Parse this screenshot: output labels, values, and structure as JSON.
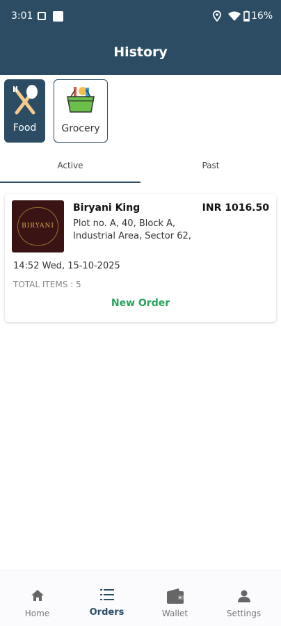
{
  "status_bar": {
    "time": "3:01",
    "battery": "16%"
  },
  "header": {
    "title": "History"
  },
  "categories": [
    {
      "label": "Food",
      "icon": "spoon-fork-icon",
      "selected": true
    },
    {
      "label": "Grocery",
      "icon": "grocery-basket-icon",
      "selected": false
    }
  ],
  "tabs": [
    {
      "label": "Active",
      "selected": true
    },
    {
      "label": "Past",
      "selected": false
    }
  ],
  "orders": [
    {
      "restaurant": "Biryani King",
      "logo_text": "BIRYANI",
      "price": "INR 1016.50",
      "address": "Plot no. A, 40, Block A, Industrial Area, Sector 62,",
      "datetime": "14:52 Wed, 15-10-2025",
      "total_items": "TOTAL ITEMS : 5",
      "status": "New Order"
    }
  ],
  "bottom_nav": [
    {
      "label": "Home",
      "icon": "home-icon",
      "active": false
    },
    {
      "label": "Orders",
      "icon": "list-icon",
      "active": true
    },
    {
      "label": "Wallet",
      "icon": "wallet-icon",
      "active": false
    },
    {
      "label": "Settings",
      "icon": "person-icon",
      "active": false
    }
  ],
  "colors": {
    "primary": "#2b4c63",
    "success": "#26a35a"
  }
}
